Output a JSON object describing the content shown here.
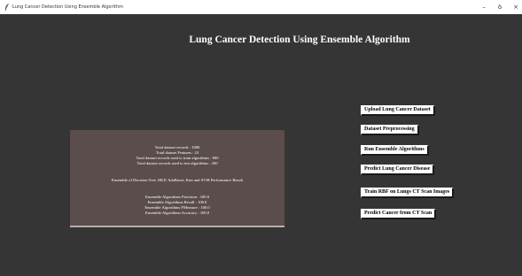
{
  "window": {
    "title": "Lung Cancer Detection Using Ensemble Algorithm",
    "icon": "feather-icon",
    "controls": {
      "minimize": "–",
      "maximize": "ꝺ",
      "close": "×"
    }
  },
  "main": {
    "heading": "Lung Cancer Detection Using Ensemble Algorithm"
  },
  "results": {
    "lines": [
      "Total dataset records : 1000",
      "Total dataset Features : 23",
      "Total dataset records used to train algorithms : 800",
      "Total dataset records used to test algorithms : 200",
      "Ensemble of Decision Tree, MLP, AdaBoost, Knn and SVM Performance Result",
      "Ensemble Algorithms Precision : 100.0",
      "Ensemble Algorithms Recall : 100.0",
      "Ensemble Algorithms FMeasure : 100.0",
      "Ensemble Algorithms Accuracy : 100.0"
    ]
  },
  "buttons": {
    "upload": "Upload Lung Cancer Dataset",
    "preprocess": "Dataset Preprocessing",
    "run_ensemble": "Run Ensemble Algorithms",
    "predict_disease": "Predict Lung Cancer Disease",
    "train_rbf": "Train RBF on Lungs CT Scan Images",
    "predict_ct": "Predict Cancer from CT Scan"
  },
  "colors": {
    "background": "#353535",
    "panel": "#5a4d4c",
    "text": "#ffffff",
    "button": "#ffffff"
  }
}
